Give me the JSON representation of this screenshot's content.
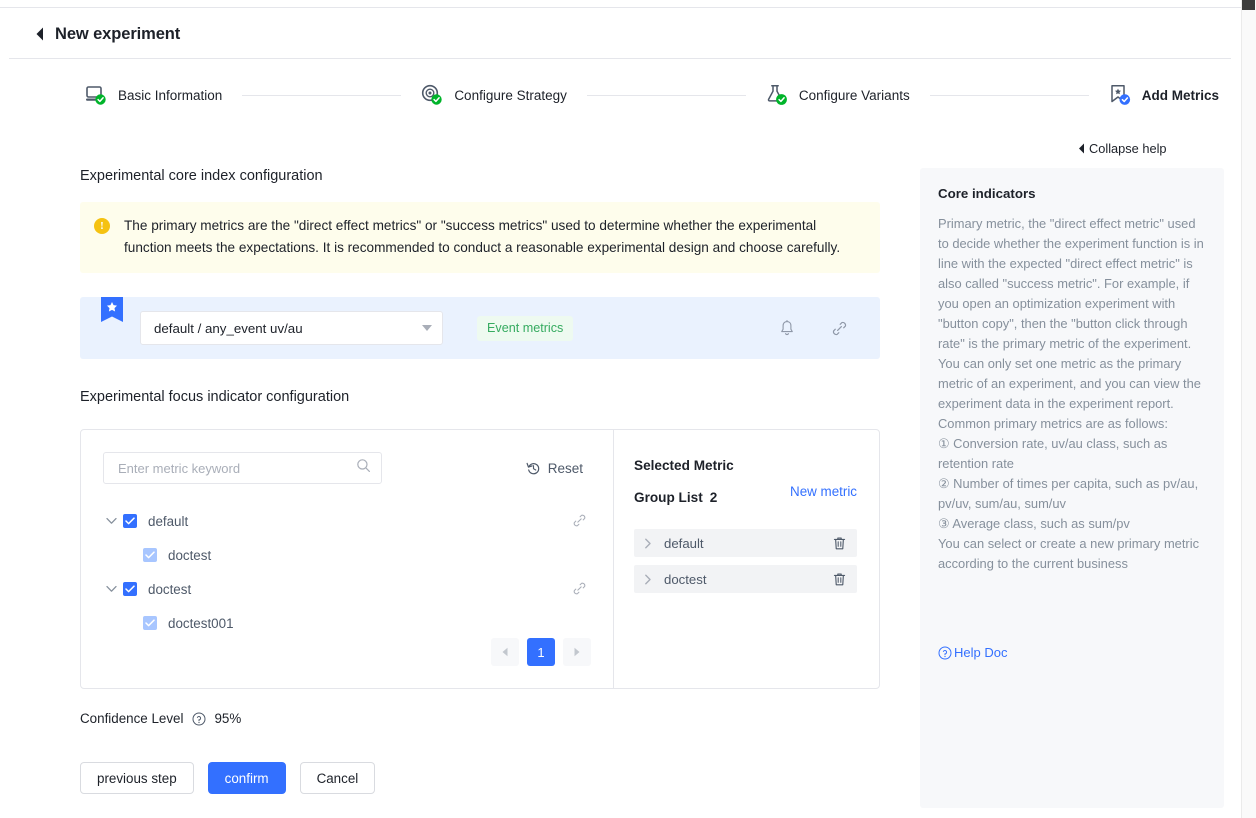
{
  "header": {
    "title": "New experiment",
    "back_icon": "back-triangle-icon"
  },
  "steps": [
    {
      "label": "Basic Information",
      "icon": "monitor-check-icon",
      "state": "done"
    },
    {
      "label": "Configure Strategy",
      "icon": "target-check-icon",
      "state": "done"
    },
    {
      "label": "Configure Variants",
      "icon": "flask-check-icon",
      "state": "done"
    },
    {
      "label": "Add Metrics",
      "icon": "bookmark-check-icon",
      "state": "active"
    }
  ],
  "collapse_help": {
    "label": "Collapse help",
    "icon": "triangle-left-icon"
  },
  "core_index": {
    "section_title": "Experimental core index configuration",
    "alert": {
      "icon": "warning-icon",
      "text": "The primary metrics are the \"direct effect metrics\" or \"success metrics\" used to determine whether the experimental function meets the expectations. It is recommended to conduct a reasonable experimental design and choose carefully."
    },
    "primary_metric": {
      "ribbon_icon": "star-ribbon-icon",
      "select_value": "default / any_event uv/au",
      "tag": "Event metrics",
      "bell_icon": "bell-icon",
      "link_icon": "link-icon"
    }
  },
  "focus_indicator": {
    "section_title": "Experimental focus indicator configuration",
    "search": {
      "placeholder": "Enter metric keyword",
      "value": "",
      "icon": "search-icon"
    },
    "reset": {
      "label": "Reset",
      "icon": "history-reset-icon"
    },
    "tree": [
      {
        "label": "default",
        "level": 0,
        "checked": true,
        "expanded": true,
        "link_icon": "link-icon"
      },
      {
        "label": "doctest",
        "level": 1,
        "checked": true,
        "expanded": false,
        "link_icon": ""
      },
      {
        "label": "doctest",
        "level": 0,
        "checked": true,
        "expanded": true,
        "link_icon": "link-icon"
      },
      {
        "label": "doctest001",
        "level": 1,
        "checked": true,
        "expanded": false,
        "link_icon": ""
      }
    ],
    "pagination": {
      "prev_icon": "caret-left-icon",
      "next_icon": "caret-right-icon",
      "current_page": "1"
    },
    "selected": {
      "title": "Selected Metric",
      "group_list_label": "Group List",
      "group_list_count": "2",
      "new_metric": "New metric",
      "items": [
        {
          "label": "default",
          "caret_icon": "caret-right-icon",
          "delete_icon": "trash-icon"
        },
        {
          "label": "doctest",
          "caret_icon": "caret-right-icon",
          "delete_icon": "trash-icon"
        }
      ]
    }
  },
  "confidence": {
    "label": "Confidence Level",
    "help_icon": "question-circle-icon",
    "value": "95%"
  },
  "footer": {
    "previous": "previous step",
    "confirm": "confirm",
    "cancel": "Cancel"
  },
  "help": {
    "title": "Core indicators",
    "body": "Primary metric, the \"direct effect metric\" used to decide whether the experiment function is in line with the expected \"direct effect metric\" is also called \"success metric\". For example, if you open an optimization experiment with \"button copy\", then the \"button click through rate\" is the primary metric of the experiment. You can only set one metric as the primary metric of an experiment, and you can view the experiment data in the experiment report. Common primary metrics are as follows:\n① Conversion rate, uv/au class, such as retention rate\n② Number of times per capita, such as pv/au, pv/uv, sum/au, sum/uv\n③ Average class, such as sum/pv\nYou can select or create a new primary metric according to the current business",
    "doc_link": "Help Doc",
    "doc_icon": "question-circle-icon"
  },
  "colors": {
    "primary": "#3370ff",
    "success": "#36ab60",
    "warning": "#f5c211",
    "alert_bg": "#fefdec",
    "metric_row_bg": "#eaf2fe",
    "panel_bg": "#f7f8fa"
  }
}
